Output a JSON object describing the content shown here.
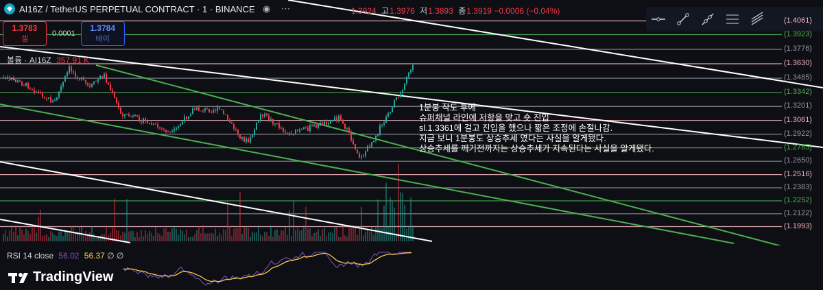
{
  "header": {
    "symbol_title": "AI16Z / TetherUS PERPETUAL CONTRACT · 1 · BINANCE",
    "ohlc": {
      "open_label": "",
      "open": "1.3924",
      "high_label": "고",
      "high": "1.3976",
      "low_label": "저",
      "low": "1.3893",
      "close_label": "종",
      "close": "1.3919",
      "change": "−0.0006 (−0.04%)"
    }
  },
  "trade": {
    "sell_price": "1.3783",
    "sell_label": "셀",
    "spread": "0.0001",
    "buy_price": "1.3784",
    "buy_label": "바이"
  },
  "volume_legend": {
    "label": "볼륨 · AI16Z",
    "value": "357.91 K"
  },
  "rsi_legend": {
    "label": "RSI 14 close",
    "value1": "56.02",
    "value2": "56.37",
    "extra": "∅ ∅"
  },
  "brand": {
    "text": "TradingView"
  },
  "price_axis": [
    {
      "label": "(1.4061)",
      "price": 1.4061,
      "color": "#f0b4bd"
    },
    {
      "label": "(1.3923)",
      "price": 1.3923,
      "color": "#4caf50"
    },
    {
      "label": "(1.3776)",
      "price": 1.3776,
      "color": "#9598a1"
    },
    {
      "label": "(1.3630)",
      "price": 1.363,
      "color": "#f0b4bd"
    },
    {
      "label": "(1.3485)",
      "price": 1.3485,
      "color": "#9598a1"
    },
    {
      "label": "(1.3342)",
      "price": 1.3342,
      "color": "#4caf50"
    },
    {
      "label": "(1.3201)",
      "price": 1.3201,
      "color": "#9598a1"
    },
    {
      "label": "(1.3061)",
      "price": 1.3061,
      "color": "#f0b4bd"
    },
    {
      "label": "(1.2922)",
      "price": 1.2922,
      "color": "#9598a1"
    },
    {
      "label": "(1.2785)",
      "price": 1.2785,
      "color": "#4caf50"
    },
    {
      "label": "(1.2650)",
      "price": 1.265,
      "color": "#9598a1"
    },
    {
      "label": "(1.2516)",
      "price": 1.2516,
      "color": "#f0b4bd"
    },
    {
      "label": "(1.2383)",
      "price": 1.2383,
      "color": "#9598a1"
    },
    {
      "label": "(1.2252)",
      "price": 1.2252,
      "color": "#4caf50"
    },
    {
      "label": "(1.2122)",
      "price": 1.2122,
      "color": "#9598a1"
    },
    {
      "label": "(1.1993)",
      "price": 1.1993,
      "color": "#f0b4bd"
    }
  ],
  "annotation": [
    "1분봉 작도 후에",
    "슈퍼채널 라인에  저항을 맞고 숏 진입",
    "sl.1.3361에 걸고 진입을 했으나 짧은 조정에 손절나감.",
    "지금 보니 1분봉도 상승추세 였다는 사실을 알게됐다.",
    "상승추세를 깨기전까지는 상승추세가 지속된다는 사실을 알게됐다."
  ],
  "toolbar_tools": [
    "horizontal-line-icon",
    "trend-line-icon",
    "ray-icon",
    "channel-icon",
    "pitchfork-icon"
  ],
  "colors": {
    "up": "#26a69a",
    "down": "#f23645",
    "rsi": "#7e57c2",
    "rsi_ma": "#f7c948",
    "green_line": "#4caf50",
    "white_line": "#ffffff"
  }
}
